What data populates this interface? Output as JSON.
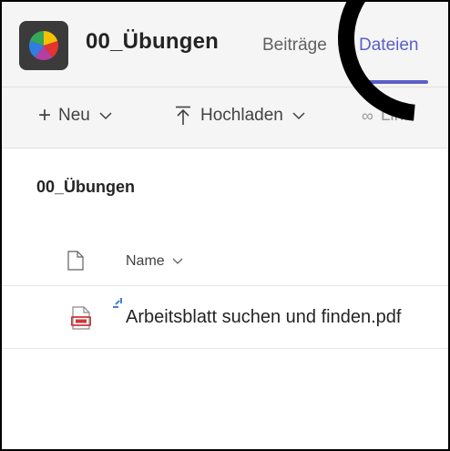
{
  "header": {
    "channel_title": "00_Übungen",
    "tabs": [
      {
        "label": "Beiträge"
      },
      {
        "label": "Dateien"
      }
    ],
    "active_tab_color": "#5b5fc7"
  },
  "toolbar": {
    "new_label": "Neu",
    "upload_label": "Hochladen",
    "link_label": "Link"
  },
  "folder": {
    "title": "00_Übungen"
  },
  "table": {
    "name_header": "Name",
    "rows": [
      {
        "name": "Arbeitsblatt suchen und finden.pdf",
        "icon": "pdf-icon"
      }
    ]
  }
}
